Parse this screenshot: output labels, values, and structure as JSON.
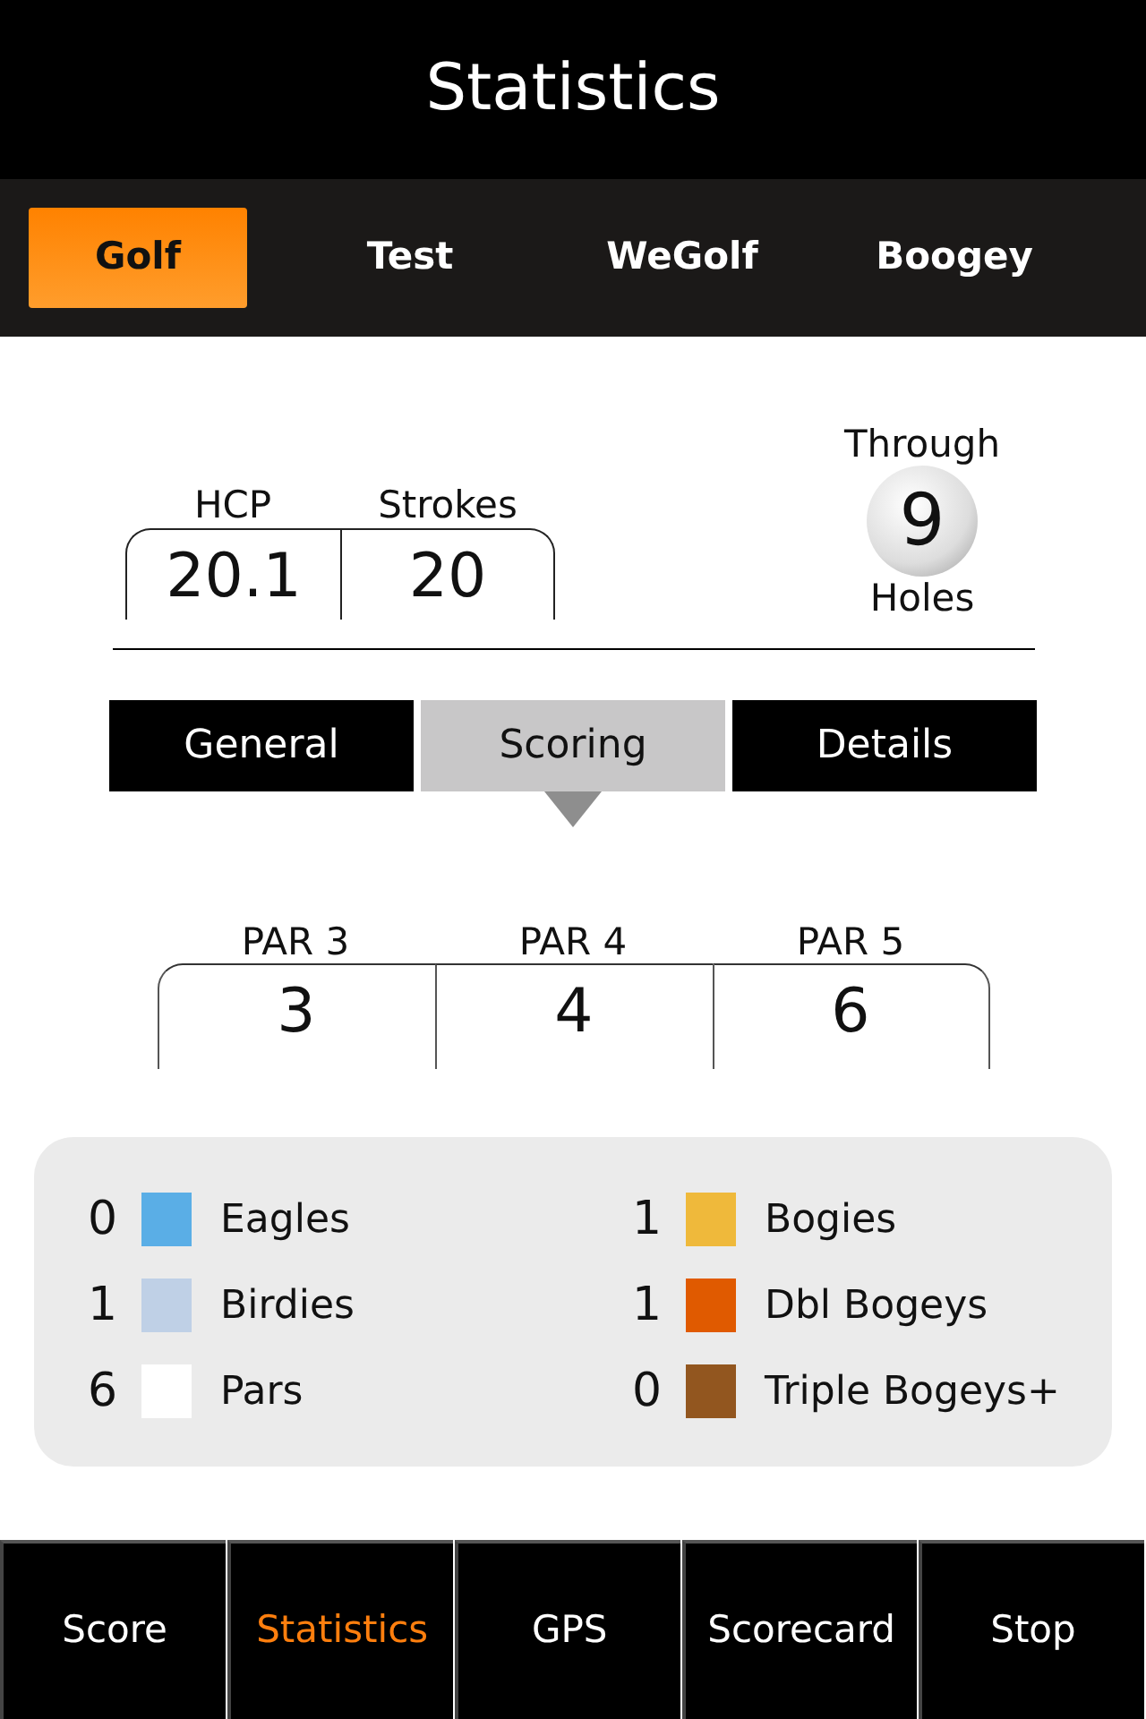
{
  "header": {
    "title": "Statistics"
  },
  "players": [
    {
      "label": "Golf",
      "selected": true
    },
    {
      "label": "Test",
      "selected": false
    },
    {
      "label": "WeGolf",
      "selected": false
    },
    {
      "label": "Boogey",
      "selected": false
    }
  ],
  "summary": {
    "stats": [
      {
        "label": "HCP",
        "value": "20.1"
      },
      {
        "label": "Strokes",
        "value": "20"
      }
    ],
    "through": {
      "top": "Through",
      "value": "9",
      "bottom": "Holes"
    }
  },
  "section_tabs": [
    {
      "label": "General",
      "selected": false
    },
    {
      "label": "Scoring",
      "selected": true
    },
    {
      "label": "Details",
      "selected": false
    }
  ],
  "par_stats": [
    {
      "label": "PAR 3",
      "value": "3"
    },
    {
      "label": "PAR 4",
      "value": "4"
    },
    {
      "label": "PAR 5",
      "value": "6"
    }
  ],
  "legend": [
    {
      "count": "0",
      "label": "Eagles",
      "color": "#5aaee6"
    },
    {
      "count": "1",
      "label": "Birdies",
      "color": "#bfd0e6"
    },
    {
      "count": "6",
      "label": "Pars",
      "color": "#ffffff"
    },
    {
      "count": "1",
      "label": "Bogies",
      "color": "#efb93b"
    },
    {
      "count": "1",
      "label": "Dbl Bogeys",
      "color": "#e05a00"
    },
    {
      "count": "0",
      "label": "Triple Bogeys+",
      "color": "#92561f"
    }
  ],
  "bottom_nav": [
    {
      "label": "Score",
      "selected": false
    },
    {
      "label": "Statistics",
      "selected": true
    },
    {
      "label": "GPS",
      "selected": false
    },
    {
      "label": "Scorecard",
      "selected": false
    },
    {
      "label": "Stop",
      "selected": false
    }
  ]
}
